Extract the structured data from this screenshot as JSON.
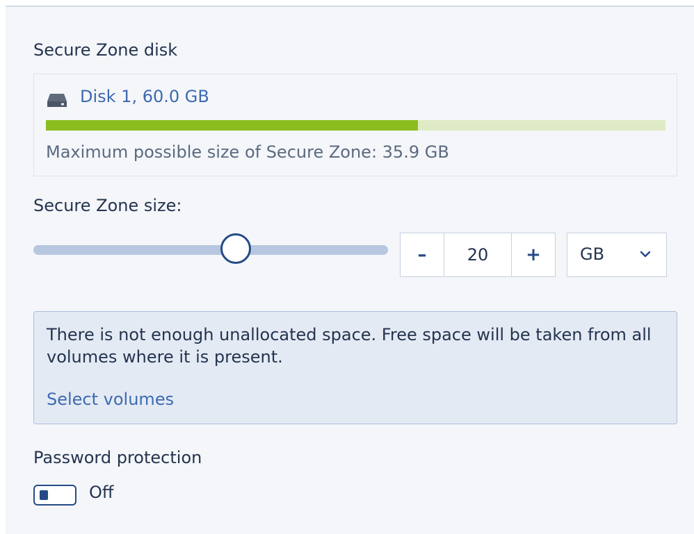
{
  "disk_section": {
    "label": "Secure Zone disk",
    "disk_name": "Disk 1, 60.0 GB",
    "usage_fraction": 0.6,
    "max_size_text": "Maximum possible size of Secure Zone: 35.9 GB"
  },
  "size_section": {
    "label": "Secure Zone size:",
    "slider_fraction": 0.57,
    "decrement_label": "–",
    "value": "20",
    "increment_label": "+",
    "unit": "GB"
  },
  "info": {
    "message": "There is not enough unallocated space. Free space will be taken from all volumes where it is present.",
    "link": "Select volumes"
  },
  "password": {
    "label": "Password protection",
    "state_label": "Off"
  },
  "colors": {
    "accent": "#254a86",
    "link": "#3d6ab0",
    "usage_fill": "#8bbd1e",
    "usage_track": "#dfebc5",
    "info_bg": "#e4eaf4"
  },
  "icons": {
    "disk": "hard-drive-icon",
    "unit_dropdown": "chevron-down-icon"
  }
}
